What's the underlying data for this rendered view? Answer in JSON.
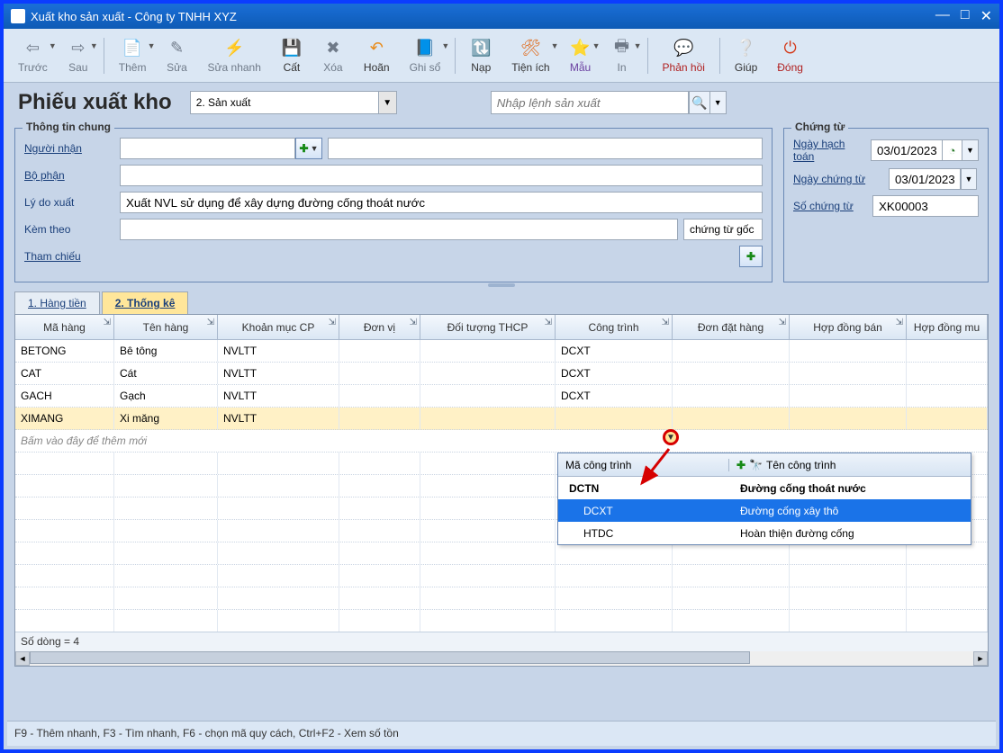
{
  "window": {
    "title": "Xuất kho sản xuất - Công ty TNHH XYZ"
  },
  "toolbar": {
    "prev": "Trước",
    "next": "Sau",
    "add": "Thêm",
    "edit": "Sửa",
    "quickedit": "Sửa nhanh",
    "save": "Cất",
    "delete": "Xóa",
    "undo": "Hoãn",
    "post": "Ghi sổ",
    "refresh": "Nạp",
    "util": "Tiện ích",
    "template": "Mẫu",
    "print": "In",
    "feedback": "Phản hồi",
    "help": "Giúp",
    "close": "Đóng"
  },
  "header": {
    "title": "Phiếu xuất kho",
    "type": "2. Sản xuất",
    "search_placeholder": "Nhập lệnh sản xuất"
  },
  "general": {
    "legend": "Thông tin chung",
    "recipient_lbl": "Người nhận",
    "recipient": "",
    "dept_lbl": "Bộ phận",
    "dept": "",
    "reason_lbl": "Lý do xuất",
    "reason": "Xuất NVL sử dụng để xây dựng đường cống thoát nước",
    "attach_lbl": "Kèm theo",
    "attach": "",
    "attach_suffix": "chứng từ gốc",
    "ref_lbl": "Tham chiếu"
  },
  "voucher": {
    "legend": "Chứng từ",
    "postdate_lbl": "Ngày hạch toán",
    "postdate": "03/01/2023",
    "vdate_lbl": "Ngày chứng từ",
    "vdate": "03/01/2023",
    "vno_lbl": "Số chứng từ",
    "vno": "XK00003"
  },
  "tabs": {
    "t1": "1. Hàng tiền",
    "t2": "2. Thống kê"
  },
  "grid": {
    "headers": {
      "ma": "Mã hàng",
      "ten": "Tên hàng",
      "km": "Khoản mục CP",
      "dv": "Đơn vị",
      "dt": "Đối tượng THCP",
      "ct": "Công trình",
      "dd": "Đơn đặt hàng",
      "hb": "Hợp đồng bán",
      "hm": "Hợp đồng mu"
    },
    "rows": [
      {
        "ma": "BETONG",
        "ten": "Bê tông",
        "km": "NVLTT",
        "ct": "DCXT"
      },
      {
        "ma": "CAT",
        "ten": "Cát",
        "km": "NVLTT",
        "ct": "DCXT"
      },
      {
        "ma": "GACH",
        "ten": "Gạch",
        "km": "NVLTT",
        "ct": "DCXT"
      },
      {
        "ma": "XIMANG",
        "ten": "Xi măng",
        "km": "NVLTT",
        "ct": ""
      }
    ],
    "add_hint": "Bấm vào đây để thêm mới",
    "footer": "Số dòng = 4"
  },
  "popup": {
    "h1": "Mã công trình",
    "h2": "Tên công trình",
    "rows": [
      {
        "code": "DCTN",
        "name": "Đường cống thoát nước",
        "bold": true
      },
      {
        "code": "DCXT",
        "name": "Đường cống xây thô",
        "hl": true,
        "indent": true
      },
      {
        "code": "HTDC",
        "name": "Hoàn thiện đường cống",
        "indent": true
      }
    ]
  },
  "status": "F9 - Thêm nhanh, F3 - Tìm nhanh, F6 - chọn mã quy cách, Ctrl+F2 - Xem số tồn"
}
